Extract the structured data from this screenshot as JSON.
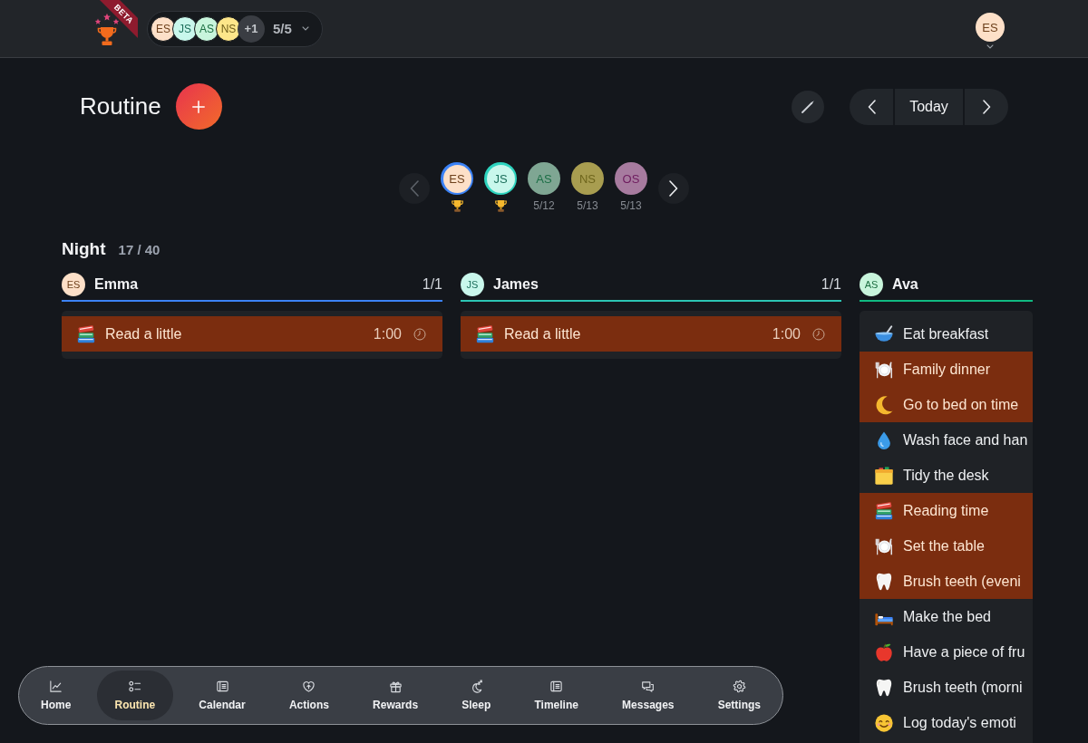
{
  "topbar": {
    "beta": "BETA",
    "members": [
      {
        "initials": "ES",
        "color": "#fde0c8"
      },
      {
        "initials": "JS",
        "color": "#c9f7ec"
      },
      {
        "initials": "AS",
        "color": "#c8f5dc"
      },
      {
        "initials": "NS",
        "color": "#fde68a"
      }
    ],
    "more": "+1",
    "count": "5/5",
    "user": {
      "initials": "ES",
      "color": "#fde0c8"
    }
  },
  "header": {
    "title": "Routine",
    "today": "Today"
  },
  "selector": {
    "prev": {
      "disabled": true
    },
    "next": {
      "disabled": false
    },
    "members": [
      {
        "initials": "ES",
        "color": "#fde0c8",
        "selected": true,
        "ring": {
          "color": "#3b82f6"
        },
        "done": true
      },
      {
        "initials": "JS",
        "color": "#c9f7ec",
        "selected": true,
        "ring": {
          "color": "#2dd4bf"
        },
        "done": true
      },
      {
        "initials": "AS",
        "color": "#7fa693",
        "selected": false,
        "done": false,
        "progress": "5/12"
      },
      {
        "initials": "NS",
        "color": "#a89d50",
        "selected": false,
        "done": false,
        "progress": "5/13"
      },
      {
        "initials": "OS",
        "color": "#a77b9f",
        "selected": false,
        "done": false,
        "progress": "5/13"
      }
    ]
  },
  "section": {
    "title": "Night",
    "count": "17 / 40"
  },
  "columns": [
    {
      "name": "Emma",
      "avatar": {
        "initials": "ES",
        "color": "#fde0c8"
      },
      "color": "#3b82f6",
      "count": "1/1",
      "tasks": [
        {
          "kind": "books",
          "label": "Read a little",
          "time": "1:00",
          "highlighted": true
        }
      ]
    },
    {
      "name": "James",
      "avatar": {
        "initials": "JS",
        "color": "#c9f7ec"
      },
      "color": "#2cc5b4",
      "count": "1/1",
      "tasks": [
        {
          "kind": "books",
          "label": "Read a little",
          "time": "1:00",
          "highlighted": true
        }
      ]
    },
    {
      "name": "Ava",
      "avatar": {
        "initials": "AS",
        "color": "#c8f5dc"
      },
      "color": "#10b981",
      "tasks": [
        {
          "kind": "bowl",
          "label": "Eat breakfast",
          "highlighted": false
        },
        {
          "kind": "plate",
          "label": "Family dinner",
          "highlighted": true
        },
        {
          "kind": "moon",
          "label": "Go to bed on time",
          "highlighted": true
        },
        {
          "kind": "drop",
          "label": "Wash face and han",
          "highlighted": false
        },
        {
          "kind": "folder",
          "label": "Tidy the desk",
          "highlighted": false
        },
        {
          "kind": "books",
          "label": "Reading time",
          "highlighted": true
        },
        {
          "kind": "plate",
          "label": "Set the table",
          "highlighted": true
        },
        {
          "kind": "tooth",
          "label": "Brush teeth (eveni",
          "highlighted": true
        },
        {
          "kind": "bed",
          "label": "Make the bed",
          "highlighted": false
        },
        {
          "kind": "apple",
          "label": "Have a piece of fru",
          "highlighted": false
        },
        {
          "kind": "tooth",
          "label": "Brush teeth (morni",
          "highlighted": false
        },
        {
          "kind": "smile",
          "label": "Log today's emoti",
          "highlighted": false
        }
      ]
    }
  ],
  "nav": [
    {
      "label": "Home",
      "kind": "chart",
      "selected": false
    },
    {
      "label": "Routine",
      "kind": "checklist",
      "selected": true
    },
    {
      "label": "Calendar",
      "kind": "list",
      "selected": false
    },
    {
      "label": "Actions",
      "kind": "heart",
      "selected": false
    },
    {
      "label": "Rewards",
      "kind": "gift",
      "selected": false
    },
    {
      "label": "Sleep",
      "kind": "moon",
      "selected": false
    },
    {
      "label": "Timeline",
      "kind": "list",
      "selected": false
    },
    {
      "label": "Messages",
      "kind": "chat",
      "selected": false
    },
    {
      "label": "Settings",
      "kind": "gear",
      "selected": false
    }
  ]
}
